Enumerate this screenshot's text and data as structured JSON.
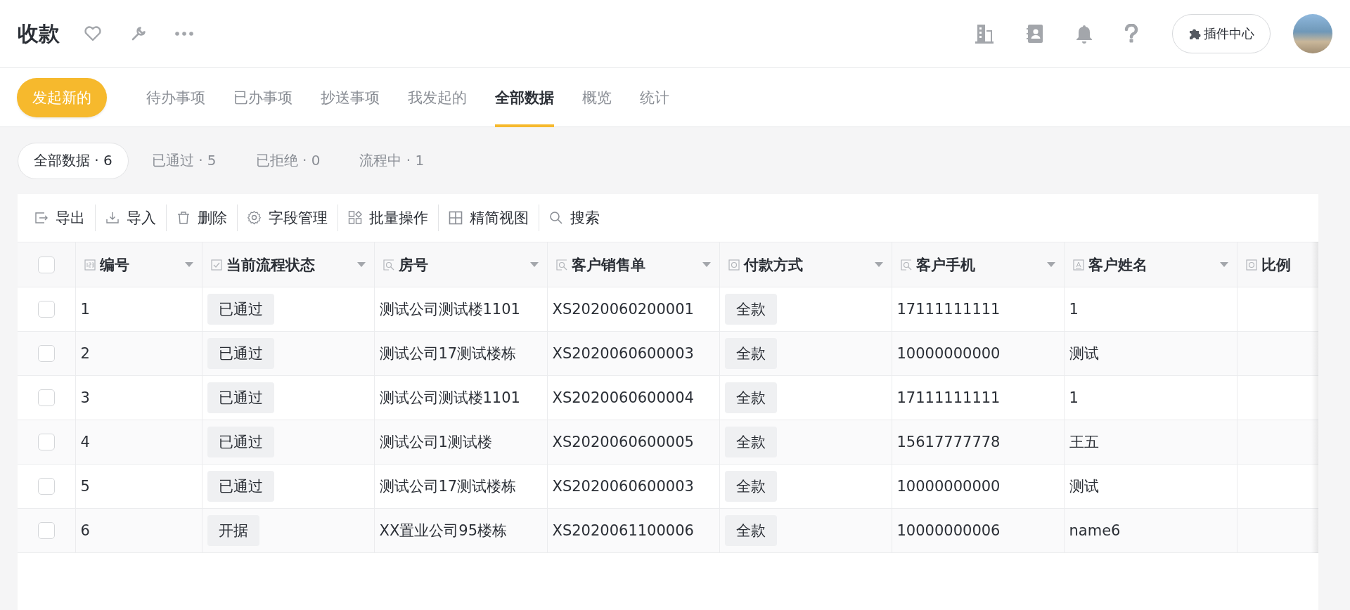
{
  "header": {
    "title": "收款",
    "plugin_button": "插件中心"
  },
  "nav": {
    "primary_button": "发起新的",
    "tabs": [
      {
        "label": "待办事项",
        "selected": false
      },
      {
        "label": "已办事项",
        "selected": false
      },
      {
        "label": "抄送事项",
        "selected": false
      },
      {
        "label": "我发起的",
        "selected": false
      },
      {
        "label": "全部数据",
        "selected": true
      },
      {
        "label": "概览",
        "selected": false
      },
      {
        "label": "统计",
        "selected": false
      }
    ]
  },
  "filters": [
    {
      "label": "全部数据 · 6",
      "selected": true
    },
    {
      "label": "已通过 · 5",
      "selected": false
    },
    {
      "label": "已拒绝 · 0",
      "selected": false
    },
    {
      "label": "流程中 · 1",
      "selected": false
    }
  ],
  "toolbar": [
    {
      "kind": "export",
      "label": "导出"
    },
    {
      "kind": "import",
      "label": "导入"
    },
    {
      "kind": "delete",
      "label": "删除"
    },
    {
      "kind": "fields",
      "label": "字段管理"
    },
    {
      "kind": "batch",
      "label": "批量操作"
    },
    {
      "kind": "view",
      "label": "精简视图"
    },
    {
      "kind": "search",
      "label": "搜索"
    }
  ],
  "table": {
    "all_checked": false,
    "columns": [
      {
        "label": "编号",
        "kind": "number"
      },
      {
        "label": "当前流程状态",
        "kind": "check"
      },
      {
        "label": "房号",
        "kind": "lookup"
      },
      {
        "label": "客户销售单",
        "kind": "lookup"
      },
      {
        "label": "付款方式",
        "kind": "select"
      },
      {
        "label": "客户手机",
        "kind": "lookup"
      },
      {
        "label": "客户姓名",
        "kind": "text"
      },
      {
        "label": "比例",
        "kind": "select"
      }
    ],
    "rows": [
      {
        "checked": false,
        "cells": [
          "1",
          "已通过",
          "测试公司测试楼1101",
          "XS2020060200001",
          "全款",
          "17111111111",
          "1",
          ""
        ]
      },
      {
        "checked": false,
        "cells": [
          "2",
          "已通过",
          "测试公司17测试楼栋",
          "XS2020060600003",
          "全款",
          "10000000000",
          "测试",
          ""
        ]
      },
      {
        "checked": false,
        "cells": [
          "3",
          "已通过",
          "测试公司测试楼1101",
          "XS2020060600004",
          "全款",
          "17111111111",
          "1",
          ""
        ]
      },
      {
        "checked": false,
        "cells": [
          "4",
          "已通过",
          "测试公司1测试楼",
          "XS2020060600005",
          "全款",
          "15617777778",
          "王五",
          ""
        ]
      },
      {
        "checked": false,
        "cells": [
          "5",
          "已通过",
          "测试公司17测试楼栋",
          "XS2020060600003",
          "全款",
          "10000000000",
          "测试",
          ""
        ]
      },
      {
        "checked": false,
        "cells": [
          "6",
          "开据",
          "XX置业公司95楼栋",
          "XS2020061100006",
          "全款",
          "10000000006",
          "name6",
          ""
        ]
      }
    ]
  }
}
